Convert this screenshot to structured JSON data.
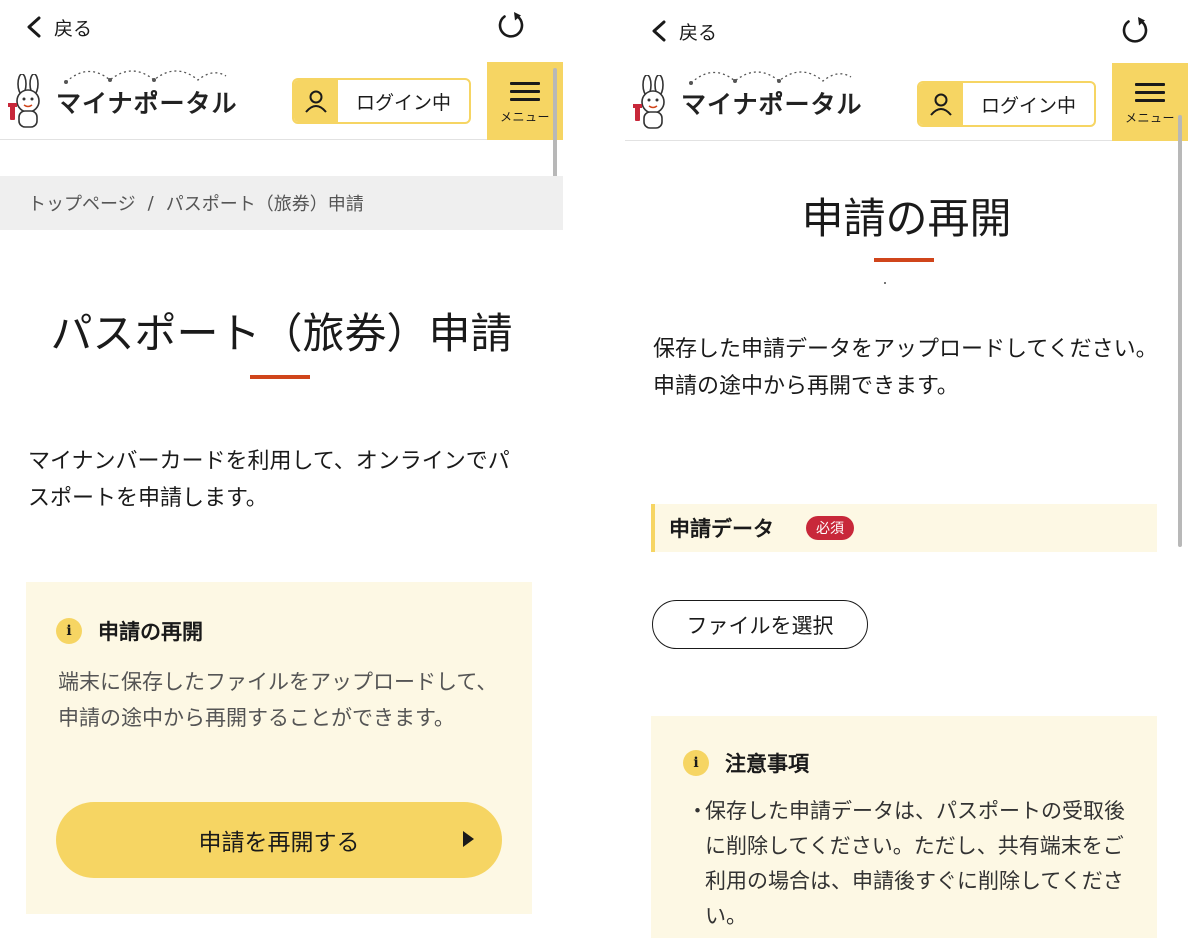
{
  "left": {
    "nav": {
      "back_label": "戻る"
    },
    "header": {
      "logo_text": "マイナポータル",
      "login_label": "ログイン中",
      "menu_label": "メニュー"
    },
    "breadcrumb": {
      "home": "トップページ",
      "separator": "/",
      "current": "パスポート（旅券）申請"
    },
    "page_title": "パスポート（旅券）申請",
    "lead": "マイナンバーカードを利用して、オンラインでパスポートを申請します。",
    "resume_card": {
      "icon": "info-icon",
      "info_glyph": "i",
      "heading": "申請の再開",
      "body": "端末に保存したファイルをアップロードして、申請の途中から再開することができます。",
      "button_label": "申請を再開する"
    }
  },
  "right": {
    "nav": {
      "back_label": "戻る"
    },
    "header": {
      "logo_text": "マイナポータル",
      "login_label": "ログイン中",
      "menu_label": "メニュー"
    },
    "page_title": "申請の再開",
    "lead": "保存した申請データをアップロードしてください。\n申請の途中から再開できます。",
    "field": {
      "label": "申請データ",
      "required_badge": "必須"
    },
    "file_button_label": "ファイルを選択",
    "notice": {
      "icon": "info-icon",
      "info_glyph": "i",
      "heading": "注意事項",
      "bullet": "・",
      "items": [
        "保存した申請データは、パスポートの受取後に削除してください。ただし、共有端末をご利用の場合は、申請後すぐに削除してください。"
      ]
    }
  },
  "colors": {
    "accent_yellow": "#f6d563",
    "card_bg": "#fdf8e4",
    "title_underline": "#d0451b",
    "required_red": "#c8283a"
  }
}
